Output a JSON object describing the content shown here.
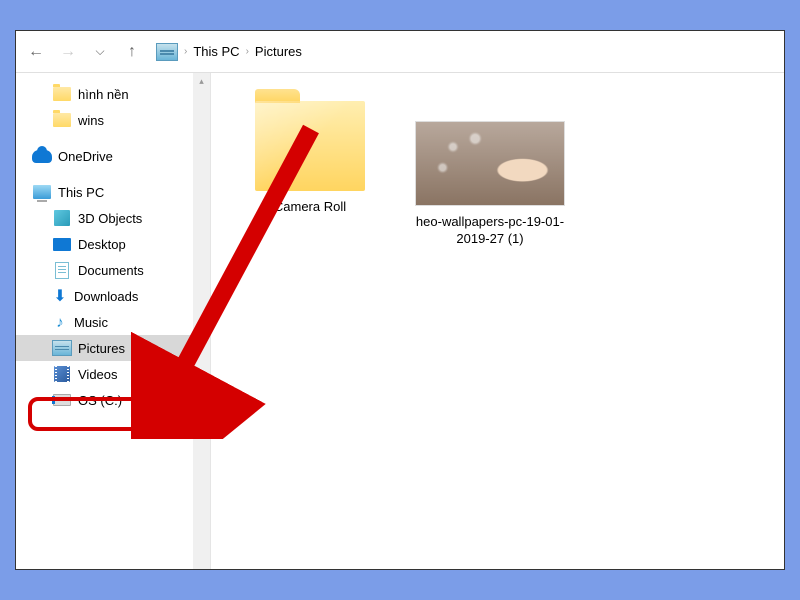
{
  "breadcrumb": {
    "items": [
      "This PC",
      "Pictures"
    ]
  },
  "sidebar": {
    "quick": [
      {
        "label": "hình nền"
      },
      {
        "label": "wins"
      }
    ],
    "onedrive": {
      "label": "OneDrive"
    },
    "thispc": {
      "label": "This PC",
      "children": [
        {
          "label": "3D Objects"
        },
        {
          "label": "Desktop"
        },
        {
          "label": "Documents"
        },
        {
          "label": "Downloads"
        },
        {
          "label": "Music"
        },
        {
          "label": "Pictures"
        },
        {
          "label": "Videos"
        },
        {
          "label": "OS (C:)"
        }
      ]
    }
  },
  "content": {
    "items": [
      {
        "label": "Camera Roll"
      },
      {
        "label": "heo-wallpapers-pc-19-01-2019-27 (1)"
      }
    ]
  }
}
